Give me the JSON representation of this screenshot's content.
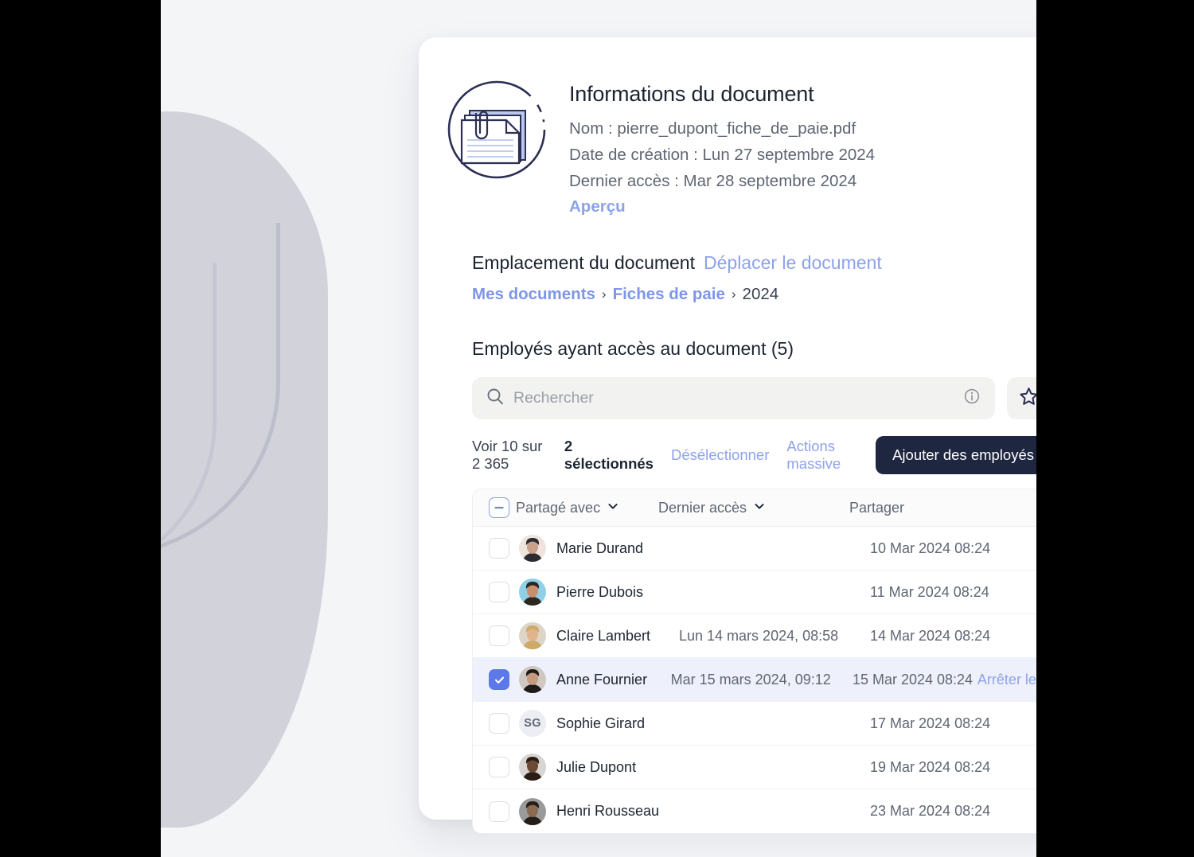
{
  "document": {
    "icon_name": "document-stack-icon",
    "title": "Informations du document",
    "name_line": "Nom : pierre_dupont_fiche_de_paie.pdf",
    "created_line": "Date de création : Lun 27 septembre 2024",
    "accessed_line": "Dernier accès : Mar 28 septembre 2024",
    "preview_link": "Aperçu",
    "close_icon": "close-icon"
  },
  "location": {
    "title": "Emplacement du document",
    "move_link": "Déplacer le document",
    "breadcrumb": [
      {
        "label": "Mes documents",
        "is_link": true
      },
      {
        "label": "Fiches de paie",
        "is_link": true
      },
      {
        "label": "2024",
        "is_link": false
      }
    ],
    "separator": "›"
  },
  "employees": {
    "heading": "Employés ayant accès au document (5)",
    "search": {
      "placeholder": "Rechercher",
      "value": "",
      "search_icon": "search-icon",
      "info_icon": "info-icon"
    },
    "star_button_icon": "star-icon",
    "toolbar": {
      "count_label": "Voir 10 sur 2 365",
      "selected_label": "2 sélectionnés",
      "deselect_label": "Désélectionner",
      "bulk_actions_label": "Actions massive",
      "add_button_label": "Ajouter des employés"
    },
    "table": {
      "columns": {
        "shared_with": "Partagé avec",
        "last_access": "Dernier accès",
        "share": "Partager"
      },
      "header_checkbox_state": "indeterminate",
      "sort_icon": "chevron-down-icon",
      "rows": [
        {
          "name": "Marie Durand",
          "avatar_type": "photo",
          "avatar_colors": [
            "#f0e3dc",
            "#c9a08a",
            "#2b2b33"
          ],
          "initials": "",
          "last_access": "",
          "share": "10 Mar 2024 08:24",
          "action": "",
          "selected": false
        },
        {
          "name": "Pierre Dubois",
          "avatar_type": "photo",
          "avatar_colors": [
            "#8fd0e8",
            "#c88f6e",
            "#2c2720"
          ],
          "initials": "",
          "last_access": "",
          "share": "11 Mar 2024 08:24",
          "action": "",
          "selected": false
        },
        {
          "name": "Claire Lambert",
          "avatar_type": "photo",
          "avatar_colors": [
            "#ddd6c8",
            "#e0b48c",
            "#cfa96a"
          ],
          "initials": "",
          "last_access": "Lun 14 mars 2024, 08:58",
          "share": "14 Mar 2024 08:24",
          "action": "",
          "selected": false
        },
        {
          "name": "Anne Fournier",
          "avatar_type": "photo",
          "avatar_colors": [
            "#cfc8c2",
            "#c59a7e",
            "#1e1a18"
          ],
          "initials": "",
          "last_access": "Mar 15 mars 2024, 09:12",
          "share": "15 Mar 2024 08:24",
          "action": "Arrêter le partage",
          "selected": true
        },
        {
          "name": "Sophie Girard",
          "avatar_type": "initials",
          "avatar_colors": [
            "#eceef4",
            "#eceef4",
            "#eceef4"
          ],
          "initials": "SG",
          "last_access": "",
          "share": "17 Mar 2024 08:24",
          "action": "",
          "selected": false
        },
        {
          "name": "Julie Dupont",
          "avatar_type": "photo",
          "avatar_colors": [
            "#d8d5d2",
            "#6b4a35",
            "#2a1d15"
          ],
          "initials": "",
          "last_access": "",
          "share": "19 Mar 2024 08:24",
          "action": "",
          "selected": false
        },
        {
          "name": "Henri Rousseau",
          "avatar_type": "photo",
          "avatar_colors": [
            "#9b9a9a",
            "#8b6a52",
            "#241d18"
          ],
          "initials": "",
          "last_access": "",
          "share": "23 Mar 2024 08:24",
          "action": "",
          "selected": false
        }
      ]
    }
  },
  "theme": {
    "accent_link": "#8da2eb",
    "accent_strong_link": "#7e95ea",
    "checkbox_checked": "#5b79e8",
    "button_dark": "#1f2740",
    "selected_row": "#eef1fc",
    "canvas_bg": "#f4f5f7",
    "card_bg": "#ffffff",
    "text_dark": "#1c2430",
    "text_muted": "#5f6672",
    "search_bg": "#f2f2f0"
  }
}
